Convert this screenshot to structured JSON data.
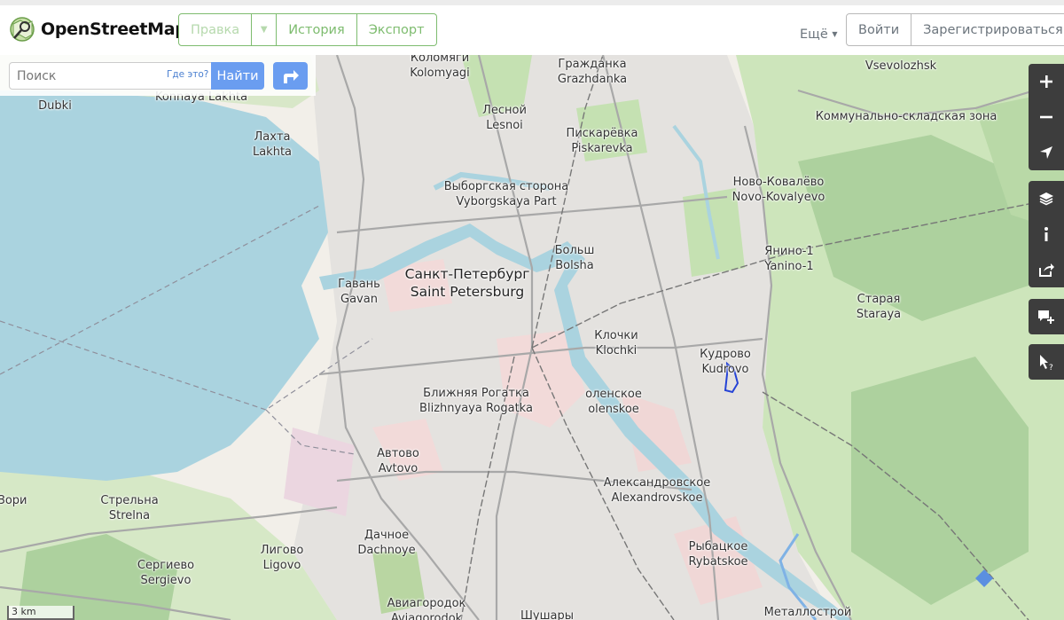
{
  "header": {
    "logo_text": "OpenStreetMap",
    "edit_label": "Правка",
    "history_label": "История",
    "export_label": "Экспорт",
    "more_label": "Ещё",
    "login_label": "Войти",
    "signup_label": "Зарегистрироваться"
  },
  "search": {
    "placeholder": "Поиск",
    "where_is_this": "Где это?",
    "button_label": "Найти"
  },
  "map": {
    "scale_label": "3 km",
    "places": [
      {
        "ru": "Коломяги",
        "en": "Kolomyagi"
      },
      {
        "ru": "Гражданка",
        "en": "Grazhdanka"
      },
      {
        "ru": "",
        "en": "Vsevolozhsk"
      },
      {
        "ru": "Dubki",
        "en": ""
      },
      {
        "ru": "Konnaya Lakhta",
        "en": ""
      },
      {
        "ru": "Лесной",
        "en": "Lesnoi"
      },
      {
        "ru": "Пискарёвка",
        "en": "Piskarevka"
      },
      {
        "ru": "Коммунально-складская зона",
        "en": ""
      },
      {
        "ru": "Лахта",
        "en": "Lakhta"
      },
      {
        "ru": "Выборгская сторона",
        "en": "Vyborgskaya Part"
      },
      {
        "ru": "Ново-Ковалёво",
        "en": "Novo-Kovalyevo"
      },
      {
        "ru": "Больш",
        "en": "Bolsha"
      },
      {
        "ru": "Янино-1",
        "en": "Yanino-1"
      },
      {
        "ru": "Санкт-Петербург",
        "en": "Saint Petersburg"
      },
      {
        "ru": "Гавань",
        "en": "Gavan"
      },
      {
        "ru": "Старая",
        "en": "Staraya"
      },
      {
        "ru": "Клочки",
        "en": "Klochki"
      },
      {
        "ru": "Кудрово",
        "en": "Kudrovo"
      },
      {
        "ru": "Ближняя Рогатка",
        "en": "Blizhnyaya Rogatka"
      },
      {
        "ru": "оленское",
        "en": "olenskoe"
      },
      {
        "ru": "Автово",
        "en": "Avtovo"
      },
      {
        "ru": "Александровское",
        "en": "Alexandrovskoe"
      },
      {
        "ru": "Стрельна",
        "en": "Strelna"
      },
      {
        "ru": "Зори",
        "en": ""
      },
      {
        "ru": "Дачное",
        "en": "Dachnoye"
      },
      {
        "ru": "Лигово",
        "en": "Ligovo"
      },
      {
        "ru": "Рыбацкое",
        "en": "Rybatskoe"
      },
      {
        "ru": "Сергиево",
        "en": "Sergievo"
      },
      {
        "ru": "Авиагородок",
        "en": "Aviagorodok"
      },
      {
        "ru": "Шушары",
        "en": ""
      },
      {
        "ru": "Металлострой",
        "en": ""
      }
    ]
  },
  "colors": {
    "accent_green": "#7ebc6f",
    "search_blue": "#6a9df0",
    "water": "#aad3df",
    "land": "#f2efe9",
    "forest": "#add19e",
    "residential": "#e0dfdf",
    "control_dark": "#3d3d3d"
  },
  "icons": {
    "zoom_in": "plus-icon",
    "zoom_out": "minus-icon",
    "locate": "location-arrow-icon",
    "layers": "layers-icon",
    "info": "info-icon",
    "share": "share-icon",
    "note": "add-note-icon",
    "query": "query-features-icon",
    "route": "directions-icon"
  }
}
